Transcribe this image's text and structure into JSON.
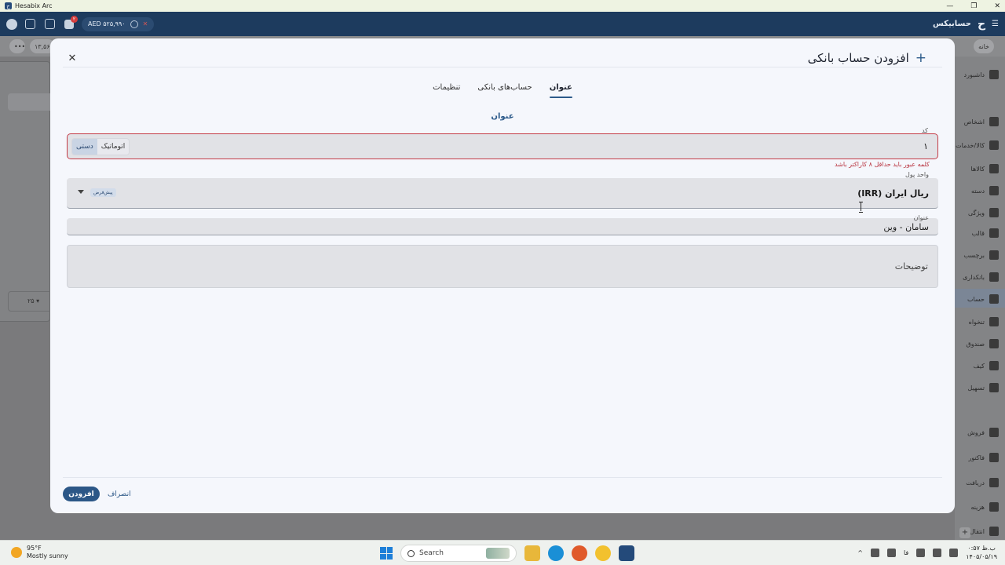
{
  "window": {
    "title": "Hesabix Arc",
    "controls": [
      "—",
      "❐",
      "✕"
    ]
  },
  "appbar": {
    "wallet": "AED ۵۲۵,۹۹۰",
    "notification_count": "۲",
    "brand": "حسابیکس"
  },
  "background": {
    "chip_left": "۱۳,۵۶",
    "chip_right": "خانه",
    "pager": "۲۵",
    "sidebar": [
      "داشبورد",
      "اشخاص",
      "کالا/خدمات",
      "کالاها",
      "دسته",
      "ویژگی",
      "قالب",
      "برچسب",
      "بانکداری",
      "حساب",
      "تنخواه",
      "صندوق",
      "کیف",
      "تسهیل",
      "فروش",
      "فاکتور",
      "دریافت",
      "هزینه",
      "انتقال"
    ]
  },
  "dialog": {
    "title": "افزودن حساب بانکی",
    "tabs": [
      {
        "label": "عنوان",
        "active": true
      },
      {
        "label": "حساب‌های بانکی",
        "active": false
      },
      {
        "label": "تنظیمات",
        "active": false
      }
    ],
    "section_title": "عنوان",
    "code_field": {
      "label": "کد",
      "value": "۱",
      "mode_auto": "اتوماتیک",
      "mode_manual": "دستی",
      "selected_mode": "manual"
    },
    "error_message": "کلمه عبور باید حداقل ۸ کاراکتر باشد",
    "currency_field": {
      "label": "واحد پول",
      "value": "ریال ایران (IRR)",
      "default_badge": "پیش‌فرض"
    },
    "title_field": {
      "label": "عنوان",
      "value": "سامان - وین"
    },
    "description_field": {
      "placeholder": "توضیحات"
    },
    "buttons": {
      "add": "افزودن",
      "cancel": "انصراف"
    }
  },
  "taskbar": {
    "weather_temp": "95°F",
    "weather_desc": "Mostly sunny",
    "search_placeholder": "Search",
    "language": "فا",
    "time": "۰:۵۷ ب.ظ",
    "date": "۱۴۰۵/۰۵/۱۹",
    "app_colors": [
      "#e8b73a",
      "#1a8fd6",
      "#e05a2b",
      "#f2c12e",
      "#244a7a"
    ]
  }
}
